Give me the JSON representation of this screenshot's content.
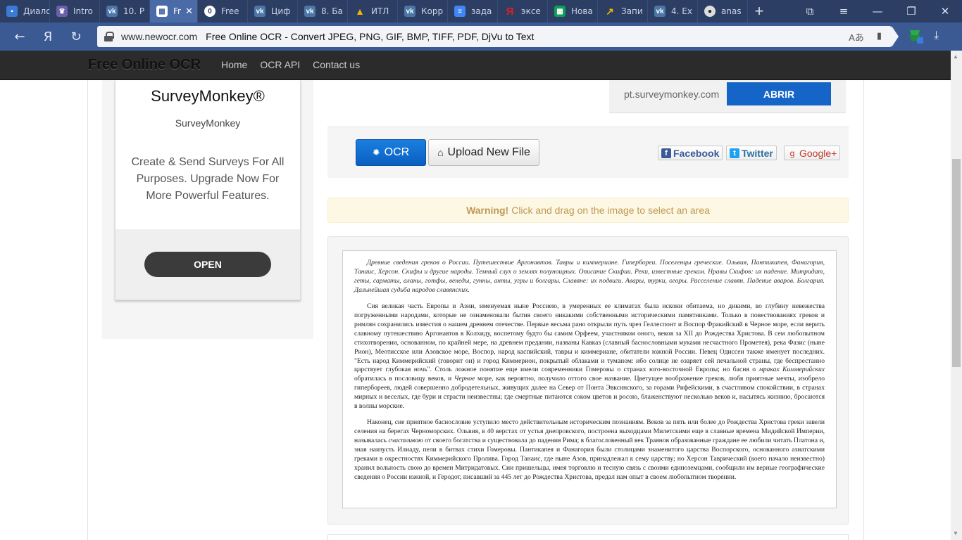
{
  "browser": {
    "tabs": [
      {
        "title": "Диалоги",
        "icon": "chat-icon",
        "color": "#3a7bd5"
      },
      {
        "title": "Intro",
        "icon": "crown-icon",
        "color": "#6b5fa8"
      },
      {
        "title": "10. Р",
        "icon": "vk-icon",
        "color": "#4a76a8"
      },
      {
        "title": "Fr",
        "icon": "table-icon",
        "color": "#4a6aa8",
        "active": true
      },
      {
        "title": "Free",
        "icon": "opera-icon",
        "color": "#2b3b6a"
      },
      {
        "title": "Циф",
        "icon": "vk-icon",
        "color": "#4a76a8"
      },
      {
        "title": "8. Ба",
        "icon": "vk-icon",
        "color": "#4a76a8"
      },
      {
        "title": "ИТЛ",
        "icon": "drive-icon",
        "color": "#0f9d58"
      },
      {
        "title": "Корр",
        "icon": "vk-icon",
        "color": "#4a76a8"
      },
      {
        "title": "зада",
        "icon": "docs-icon",
        "color": "#4285f4"
      },
      {
        "title": "эксе",
        "icon": "yandex-icon",
        "color": "#e02020"
      },
      {
        "title": "Нова",
        "icon": "sheets-icon",
        "color": "#0f9d58"
      },
      {
        "title": "Запи",
        "icon": "chart-icon",
        "color": "#2a4a7a"
      },
      {
        "title": "4. Ex",
        "icon": "vk-icon",
        "color": "#4a76a8"
      },
      {
        "title": "anas",
        "icon": "github-icon",
        "color": "#222222"
      }
    ],
    "close_tab_glyph": "✕",
    "new_tab_glyph": "+",
    "window_controls": {
      "bookmarks": "⧉",
      "menu": "≡",
      "minimize": "—",
      "restore": "❐",
      "close": "✕"
    },
    "nav": {
      "back": "←",
      "yandex": "Я",
      "reload": "↻"
    },
    "address": {
      "domain": "www.newocr.com",
      "page_title": "Free Online OCR - Convert JPEG, PNG, GIF, BMP, TIFF, PDF, DjVu to Text",
      "translate_glyph": "Aあ",
      "bookmark_glyph": "▮"
    },
    "download_glyph": "⤓"
  },
  "site": {
    "brand": "Free Online OCR",
    "nav": [
      "Home",
      "OCR API",
      "Contact us"
    ]
  },
  "ad_left": {
    "title": "SurveyMonkey®",
    "subtitle": "SurveyMonkey",
    "text": "Create & Send Surveys For All Purposes. Upgrade Now For More Powerful Features.",
    "button": "OPEN"
  },
  "ad_top": {
    "url": "pt.surveymonkey.com",
    "button": "ABRIR"
  },
  "toolbar": {
    "ocr_label": "OCR",
    "upload_label": "Upload New File",
    "share": {
      "facebook": "Facebook",
      "twitter": "Twitter",
      "google": "Google+"
    }
  },
  "warning": {
    "strong": "Warning!",
    "text": "Click and drag on the image to select an area"
  },
  "document": {
    "summary": "Древние сведения греков о России. Путешествие Аргонавтов. Тавры и киммериане. Гипербореи. Поселенцы греческие. Ольвия, Пантикапея, Фанагория, Танаис, Херсон. Скифы и другие народы. Темный слух о землях полунощных. Описание Скифии. Реки, известные грекам. Нравы Скифов: их падение. Митридат, геты, сарматы, аланы, готфы, венеды, гунны, анты, угры и болгары. Славяне: их подвиги. Авары, турки, огоры. Расселение славян. Падение аваров. Болгария. Дальнейшая судьба народов славянских.",
    "p1_a": "Сия великая часть Европы и Азии, именуемая ныне Россиею, в умеренных ее климатах была искони обитаема, но дикими, во глубину невежества погруженными народами, которые не ознаменовали бытия своего никакими собственными историческими памятниками. Только в повествованиях греков и римлян сохранились известия о нашем древнем отечестве. Первые весьма рано открыли путь чрез Геллеспонт и Воспор Фракийский в Черное море, если верить славному путешествию Аргонавтов в Колхиду, воспетому будто бы самим Орфеем, участником оного, веков за XII до Рождества Христова. В сем любопытном стихотворении, основанном, по крайней мере, на древнем предании, названы Кавказ (славный баснословными муками несчастного Прометея), река Фазис (ныне Рион), Меотисское или Азовское море, Воспор, народ каспийский, тавры и киммериане, обитатели южной России. Певец Одиссеи также именует последних. \"Есть народ Киммерийский (говорит он) и город Киммерион, покрытый облаками и туманом: ибо солнце не озаряет сей печальной страны, где беспрестанно царствует глубокая ночь\". Столь ложное понятие еще имели современники Гомеровы о странах юго-восточной Европы; но басня о ",
    "p1_em1": "мраках Киммерийских",
    "p1_b": " обратилась в пословицу веков, и ",
    "p1_em2": "Черное",
    "p1_c": " море, как вероятно, получило оттого свое название. Цветущее воображение греков, любя приятные мечты, изобрело гипербореев, людей совершенно добродетельных, живущих далее на Север от Понта Эвксинского, за горами Рифейскими, в счастливом спокойствии, в странах мирных и веселых, где бури и страсти неизвестны; где смертные питаются соком цветов и росою, блаженствуют несколько веков и, насытясь жизнию, бросаются в волны морские.",
    "p2_a": "Наконец, сие приятное баснословие уступило место действительным историческим познаниям. Веков за пять или более до Рождества Христова греки завели селения на берегах Черноморских. Ольвия, в 40 верстах от устья днепровского, построена выходцами Милетскими еще в славные времена Мидийской Империи, называлась ",
    "p2_em": "счастливою",
    "p2_b": " от своего богатства и существовала до падения Рима; в благословенный век Траянов образованные граждане ее любили читать Платона и, зная наизусть Илиаду, пели в битвах стихи Гомеровы. Пантикапея и Фанагория были столицами знаменитого царства Воспорского, основанного азиатскими греками в окрестностях Киммерийского Пролива. Город Танаис, где ныне Азов, принадлежал к сему царству; но Херсон Таврический (коего начало неизвестно) хранил вольность свою до времен Митридатовых. Сии пришельцы, имея торговлю и тесную связь с своими единоземцами, сообщили им верные географические сведения о России южной, и Геродот, писавший за 445 лет до Рождества Христова, предал нам опыт в своем любопытном творении."
  }
}
